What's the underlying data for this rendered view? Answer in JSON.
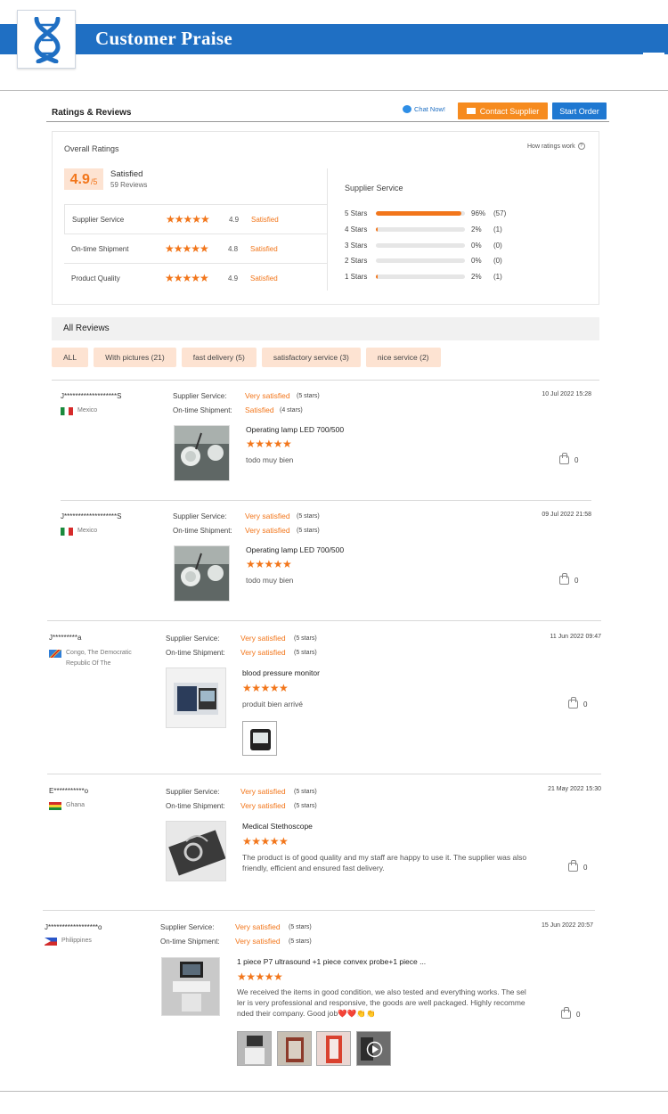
{
  "banner": {
    "title": "Customer Praise",
    "logo_icon": "dna-icon",
    "menu_icon": "hamburger-menu-icon",
    "color": "#1f6fc3"
  },
  "header": {
    "title": "Ratings & Reviews",
    "chat_label": "Chat Now!",
    "contact_label": "Contact Supplier",
    "order_label": "Start Order"
  },
  "overall": {
    "title": "Overall Ratings",
    "how_label": "How ratings work",
    "score": "4.9",
    "score_suffix": "/5",
    "score_label": "Satisfied",
    "reviews_count": "59 Reviews",
    "categories": [
      {
        "name": "Supplier Service",
        "stars": "★★★★★",
        "score": "4.9",
        "text": "Satisfied"
      },
      {
        "name": "On-time Shipment",
        "stars": "★★★★★",
        "score": "4.8",
        "text": "Satisfied"
      },
      {
        "name": "Product Quality",
        "stars": "★★★★★",
        "score": "4.9",
        "text": "Satisfied"
      }
    ],
    "service_title": "Supplier Service",
    "distribution": [
      {
        "label": "5 Stars",
        "fraction": 0.96,
        "pct": "96%",
        "count": "(57)"
      },
      {
        "label": "4 Stars",
        "fraction": 0.02,
        "pct": "2%",
        "count": "(1)"
      },
      {
        "label": "3 Stars",
        "fraction": 0,
        "pct": "0%",
        "count": "(0)"
      },
      {
        "label": "2 Stars",
        "fraction": 0,
        "pct": "0%",
        "count": "(0)"
      },
      {
        "label": "1 Stars",
        "fraction": 0.02,
        "pct": "2%",
        "count": "(1)"
      }
    ]
  },
  "all_reviews": {
    "title": "All Reviews",
    "filters": [
      "ALL",
      "With pictures (21)",
      "fast delivery (5)",
      "satisfactory service (3)",
      "nice service (2)"
    ]
  },
  "reviews": [
    {
      "user": "J*******************S",
      "country": "Mexico",
      "flag": "mx",
      "supplier_label": "Supplier Service:",
      "supplier_value": "Very satisfied",
      "supplier_stars": "(5 stars)",
      "shipment_label": "On-time Shipment:",
      "shipment_value": "Satisfied",
      "shipment_stars": "(4 stars)",
      "date": "10 Jul 2022 15:28",
      "product": "Operating lamp LED 700/500",
      "stars": "★★★★★",
      "text": "todo muy bien",
      "likes": "0"
    },
    {
      "user": "J*******************S",
      "country": "Mexico",
      "flag": "mx",
      "supplier_label": "Supplier Service:",
      "supplier_value": "Very satisfied",
      "supplier_stars": "(5 stars)",
      "shipment_label": "On-time Shipment:",
      "shipment_value": "Very satisfied",
      "shipment_stars": "(5 stars)",
      "date": "09 Jul 2022 21:58",
      "product": "Operating lamp LED 700/500",
      "stars": "★★★★★",
      "text": "todo muy bien",
      "likes": "0"
    },
    {
      "user": "J*********a",
      "country": "Congo, The Democratic Republic Of The",
      "flag": "cd",
      "supplier_label": "Supplier Service:",
      "supplier_value": "Very satisfied",
      "supplier_stars": "(5 stars)",
      "shipment_label": "On-time Shipment:",
      "shipment_value": "Very satisfied",
      "shipment_stars": "(5 stars)",
      "date": "11 Jun 2022 09:47",
      "product": "blood pressure monitor",
      "stars": "★★★★★",
      "text": "produit bien arrivé",
      "likes": "0"
    },
    {
      "user": "E***********o",
      "country": "Ghana",
      "flag": "gh",
      "supplier_label": "Supplier Service:",
      "supplier_value": "Very satisfied",
      "supplier_stars": "(5 stars)",
      "shipment_label": "On-time Shipment:",
      "shipment_value": "Very satisfied",
      "shipment_stars": "(5 stars)",
      "date": "21 May 2022 15:30",
      "product": "Medical Stethoscope",
      "stars": "★★★★★",
      "text": "The product is of good quality and my staff are happy to use it. The supplier was also friendly, efficient and ensured fast delivery.",
      "likes": "0"
    },
    {
      "user": "J******************o",
      "country": "Philippines",
      "flag": "ph",
      "supplier_label": "Supplier Service:",
      "supplier_value": "Very satisfied",
      "supplier_stars": "(5 stars)",
      "shipment_label": "On-time Shipment:",
      "shipment_value": "Very satisfied",
      "shipment_stars": "(5 stars)",
      "date": "15 Jun 2022 20:57",
      "product": "1 piece P7 ultrasound +1 piece convex probe+1 piece ...",
      "stars": "★★★★★",
      "text": "We received the items in good condition, we also tested and everything works. The seller is very professional and responsive, the goods are well packaged. Highly recommended their company. Good job❤️❤️👏👏",
      "likes": "0"
    }
  ]
}
